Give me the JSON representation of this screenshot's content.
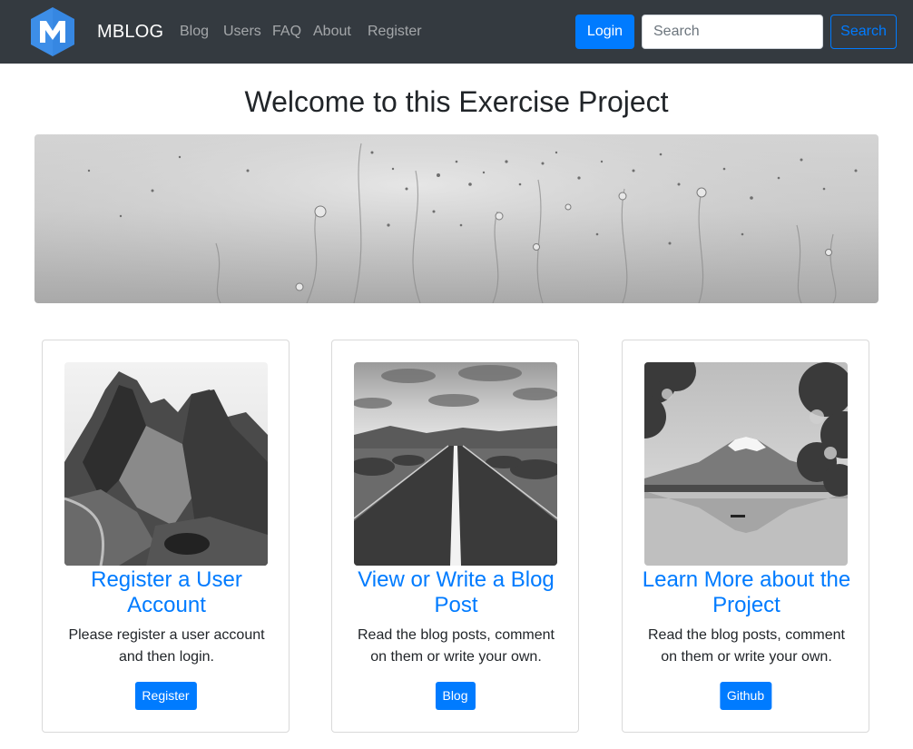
{
  "navbar": {
    "brand": "MBLOG",
    "links": [
      "Blog",
      "Users",
      "FAQ",
      "About",
      "Register"
    ],
    "login_label": "Login",
    "search_placeholder": "Search",
    "search_button_label": "Search"
  },
  "main": {
    "title": "Welcome to this Exercise Project"
  },
  "cards": [
    {
      "title": "Register a User Account",
      "text": "Please register a user account and then login.",
      "button": "Register"
    },
    {
      "title": "View or Write a Blog Post",
      "text": "Read the blog posts, comment on them or write your own.",
      "button": "Blog"
    },
    {
      "title": "Learn More about the Project",
      "text": "Read the blog posts, comment on them or write your own.",
      "button": "Github"
    }
  ],
  "colors": {
    "navbar_bg": "#343a40",
    "primary": "#007bff",
    "logo": "#4a90e2"
  },
  "icons": [
    "mblog-logo-icon"
  ]
}
